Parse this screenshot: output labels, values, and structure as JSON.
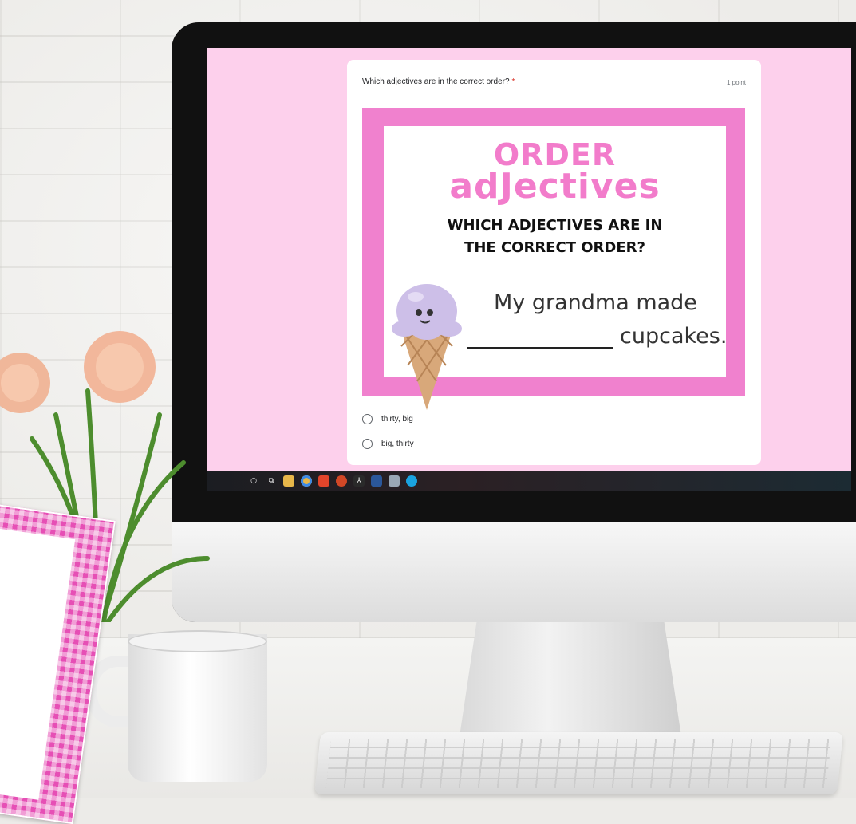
{
  "form": {
    "question": "Which adjectives are in the correct order?",
    "required_mark": "*",
    "points": "1 point",
    "image": {
      "title_line1": "ORDER",
      "title_line2": "adJectives",
      "subtitle_line1": "WHICH ADJECTIVES ARE IN",
      "subtitle_line2": "THE CORRECT ORDER?",
      "sentence_line1": "My grandma made",
      "sentence_line2": "cupcakes."
    },
    "options": [
      {
        "label": "thirty, big"
      },
      {
        "label": "big, thirty"
      }
    ]
  },
  "taskbar": {
    "icons": [
      "search-icon",
      "task-view-icon",
      "file-explorer-icon",
      "chrome-icon",
      "office-icon",
      "powerpoint-icon",
      "acrobat-icon",
      "word-icon",
      "app-icon",
      "edge-icon"
    ]
  },
  "colors": {
    "screen_background": "#fdd0ec",
    "image_frame": "#f081ce",
    "title_pink": "#f27ccb",
    "required_red": "#d93025"
  }
}
